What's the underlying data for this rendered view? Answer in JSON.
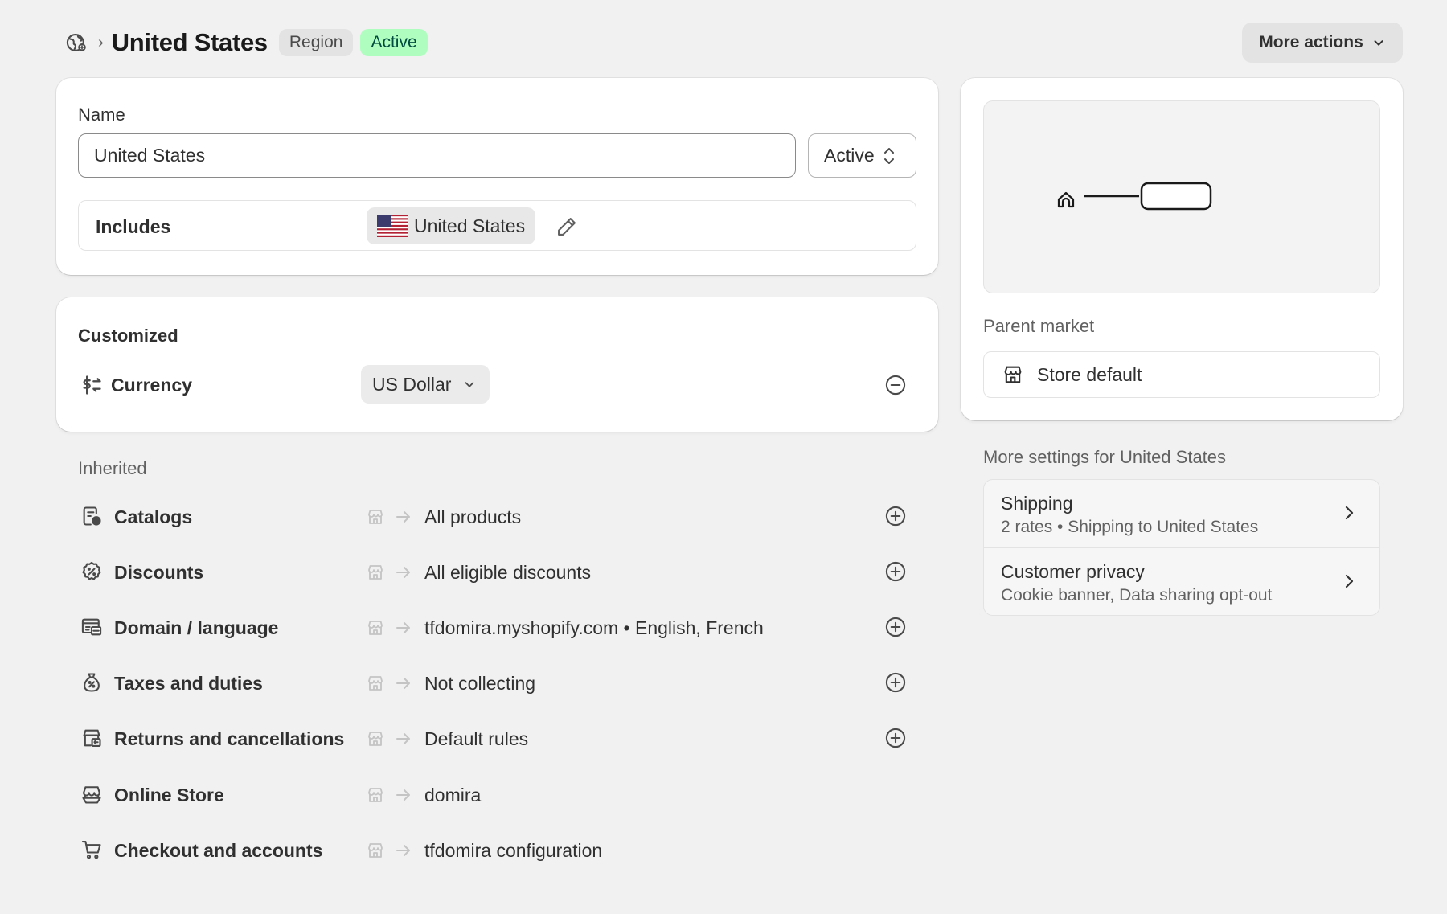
{
  "header": {
    "title": "United States",
    "region_badge": "Region",
    "status_badge": "Active",
    "more_actions": "More actions"
  },
  "name_card": {
    "name_label": "Name",
    "name_value": "United States",
    "status_value": "Active",
    "includes_label": "Includes",
    "includes_country": "United States"
  },
  "customized": {
    "title": "Customized",
    "currency_label": "Currency",
    "currency_value": "US Dollar"
  },
  "inherited": {
    "title": "Inherited",
    "rows": [
      {
        "label": "Catalogs",
        "value": "All products",
        "icon": "catalog-icon",
        "addable": true
      },
      {
        "label": "Discounts",
        "value": "All eligible discounts",
        "icon": "discount-icon",
        "addable": true
      },
      {
        "label": "Domain / language",
        "value": "tfdomira.myshopify.com • English, French",
        "icon": "domain-icon",
        "addable": true
      },
      {
        "label": "Taxes and duties",
        "value": "Not collecting",
        "icon": "tax-icon",
        "addable": true
      },
      {
        "label": "Returns and cancellations",
        "value": "Default rules",
        "icon": "returns-icon",
        "addable": true
      },
      {
        "label": "Online Store",
        "value": "domira",
        "icon": "online-store-icon",
        "addable": false
      },
      {
        "label": "Checkout and accounts",
        "value": "tfdomira configuration",
        "icon": "cart-icon",
        "addable": false
      }
    ]
  },
  "parent_market": {
    "label": "Parent market",
    "value": "Store default"
  },
  "more_settings": {
    "title": "More settings for United States",
    "items": [
      {
        "title": "Shipping",
        "subtitle": "2 rates • Shipping to United States"
      },
      {
        "title": "Customer privacy",
        "subtitle": "Cookie banner, Data sharing opt-out"
      }
    ]
  },
  "colors": {
    "background": "#f1f1f1",
    "card": "#ffffff",
    "active_badge_bg": "#affebf",
    "active_badge_text": "#014b40",
    "region_badge_bg": "#e3e3e3"
  }
}
